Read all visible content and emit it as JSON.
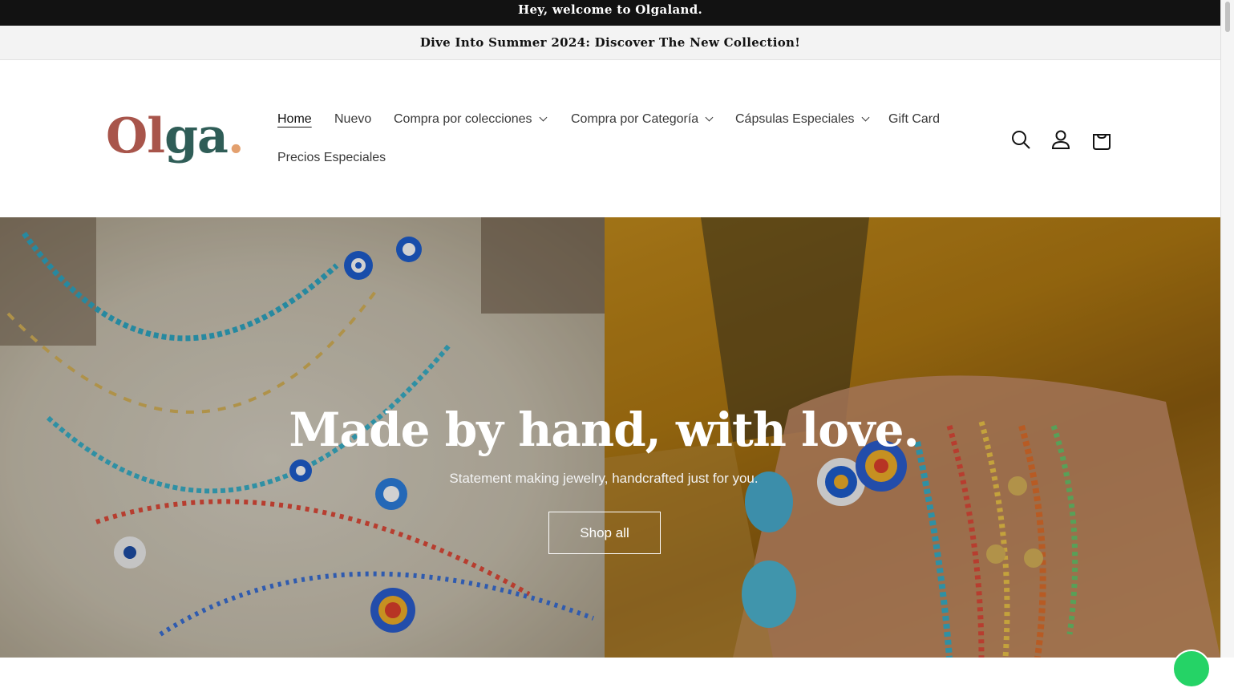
{
  "top_bar": {
    "text": "Hey, welcome to Olgaland."
  },
  "announcement": {
    "text": "Dive Into Summer 2024: Discover The New Collection!"
  },
  "logo": {
    "text": "Olga."
  },
  "nav": {
    "items": [
      {
        "label": "Home",
        "active": true,
        "has_dropdown": false
      },
      {
        "label": "Nuevo",
        "active": false,
        "has_dropdown": false
      },
      {
        "label": "Compra por colecciones",
        "active": false,
        "has_dropdown": true
      },
      {
        "label": "Compra por Categoría",
        "active": false,
        "has_dropdown": true
      },
      {
        "label": "Cápsulas Especiales",
        "active": false,
        "has_dropdown": true
      },
      {
        "label": "Gift Card",
        "active": false,
        "has_dropdown": false
      },
      {
        "label": "Precios Especiales",
        "active": false,
        "has_dropdown": false
      }
    ]
  },
  "header_icons": [
    "search-icon",
    "account-icon",
    "cart-icon"
  ],
  "hero": {
    "title": "Made by hand, with love.",
    "subtitle": "Statement making jewelry, handcrafted just for you.",
    "button_label": "Shop all"
  },
  "colors": {
    "top_bar_bg": "#121212",
    "announcement_bg": "#f3f3f3",
    "logo_primary": "#a8554b",
    "logo_secondary": "#2f5d57",
    "logo_dot": "#e3a06e",
    "chat_widget": "#25d366"
  }
}
